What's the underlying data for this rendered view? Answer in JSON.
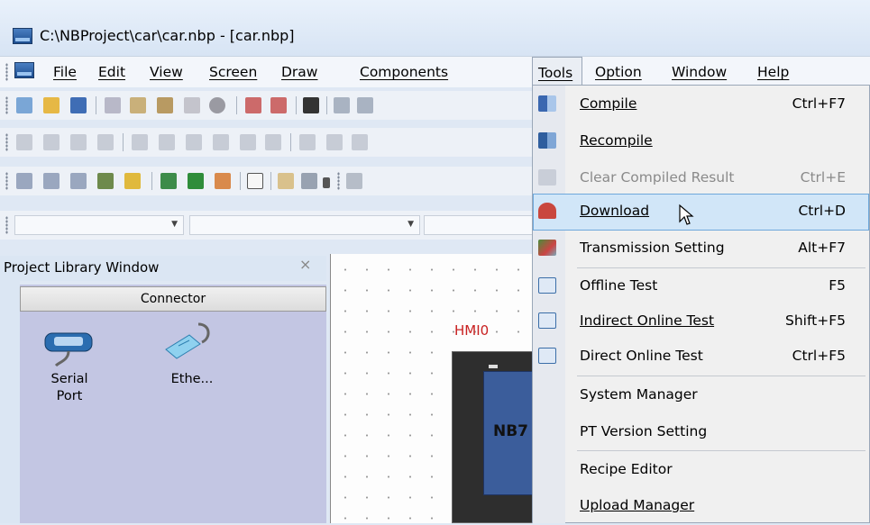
{
  "window": {
    "title": "C:\\NBProject\\car\\car.nbp - [car.nbp]"
  },
  "menubar": {
    "items": [
      "File",
      "Edit",
      "View",
      "Screen",
      "Draw",
      "Components",
      "Tools",
      "Option",
      "Window",
      "Help"
    ]
  },
  "tools_menu": {
    "items": [
      {
        "label": "Compile",
        "shortcut": "Ctrl+F7",
        "icon": "compile-icon"
      },
      {
        "label": "Recompile",
        "shortcut": "",
        "icon": "recompile-icon"
      },
      {
        "label": "Clear Compiled Result",
        "shortcut": "Ctrl+E",
        "icon": "clear-compiled-icon",
        "disabled": true
      },
      {
        "label": "Download",
        "shortcut": "Ctrl+D",
        "icon": "download-icon",
        "highlighted": true
      },
      {
        "label": "Transmission Setting",
        "shortcut": "Alt+F7",
        "icon": "transmission-icon"
      },
      {
        "label": "Offline Test",
        "shortcut": "F5",
        "icon": "offline-test-icon"
      },
      {
        "label": "Indirect Online Test",
        "shortcut": "Shift+F5",
        "icon": "indirect-online-icon"
      },
      {
        "label": "Direct Online Test",
        "shortcut": "Ctrl+F5",
        "icon": "direct-online-icon"
      },
      {
        "label": "System Manager",
        "shortcut": ""
      },
      {
        "label": "PT Version Setting",
        "shortcut": ""
      },
      {
        "label": "Recipe Editor",
        "shortcut": ""
      },
      {
        "label": "Upload Manager",
        "shortcut": ""
      }
    ]
  },
  "panel": {
    "title": "Project Library Window",
    "close": "×",
    "tab": "Connector",
    "items": [
      {
        "label_line1": "Serial",
        "label_line2": "Port",
        "icon": "serial-port-icon"
      },
      {
        "label_line1": "Ethe...",
        "label_line2": "",
        "icon": "ethernet-icon"
      }
    ]
  },
  "canvas": {
    "hmi_label": "HMI0",
    "device_text": "NB7"
  },
  "colors": {
    "highlight": "#d1e6f8",
    "hmi_label": "#c81f1f",
    "panel_bg": "#c3c6e3"
  }
}
